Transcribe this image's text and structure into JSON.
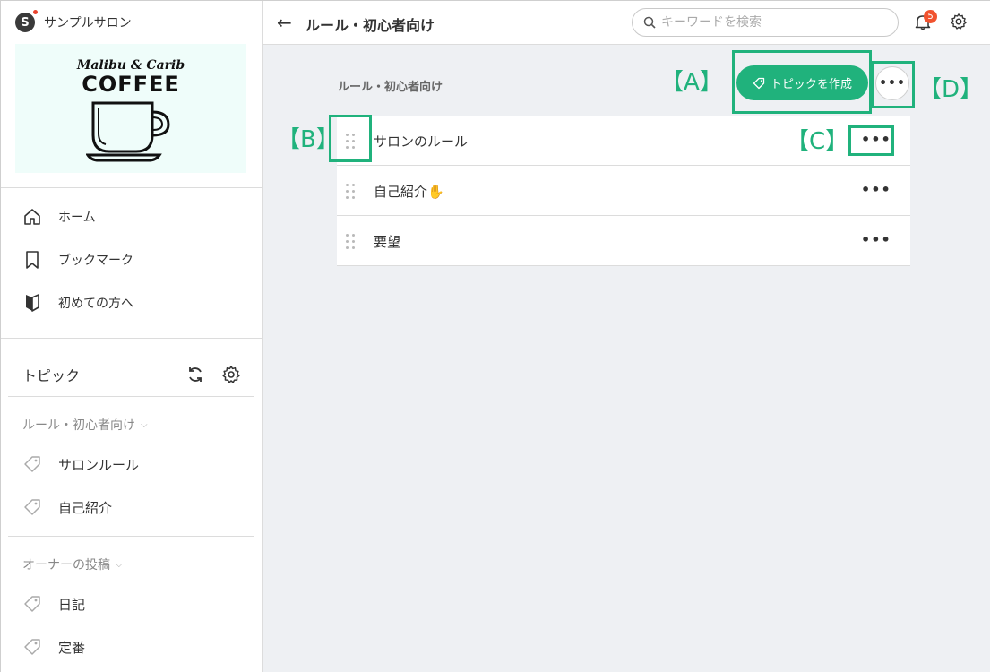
{
  "brand": {
    "name": "サンプルサロン",
    "logo_letter": "S"
  },
  "banner": {
    "script_text": "Malibu & Carib",
    "title": "COFFEE"
  },
  "nav": {
    "home": "ホーム",
    "bookmark": "ブックマーク",
    "beginner": "初めての方へ"
  },
  "topics": {
    "title": "トピック",
    "groups": [
      {
        "label": "ルール・初心者向け",
        "items": [
          "サロンルール",
          "自己紹介"
        ]
      },
      {
        "label": "オーナーの投稿",
        "items": [
          "日記",
          "定番"
        ]
      }
    ]
  },
  "topbar": {
    "title": "ルール・初心者向け",
    "search_placeholder": "キーワードを検索",
    "notification_count": "5"
  },
  "main": {
    "section_label": "ルール・初心者向け",
    "create_button": "トピックを作成",
    "more": "•••",
    "rows": [
      {
        "label": "サロンのルール",
        "more": "•••"
      },
      {
        "label": "自己紹介✋",
        "more": "•••"
      },
      {
        "label": "要望",
        "more": "•••"
      }
    ]
  },
  "annotations": {
    "a": "【A】",
    "b": "【B】",
    "c": "【C】",
    "d": "【D】"
  },
  "colors": {
    "accent": "#20b27c",
    "badge": "#f1522e",
    "background": "#eef0f3"
  }
}
